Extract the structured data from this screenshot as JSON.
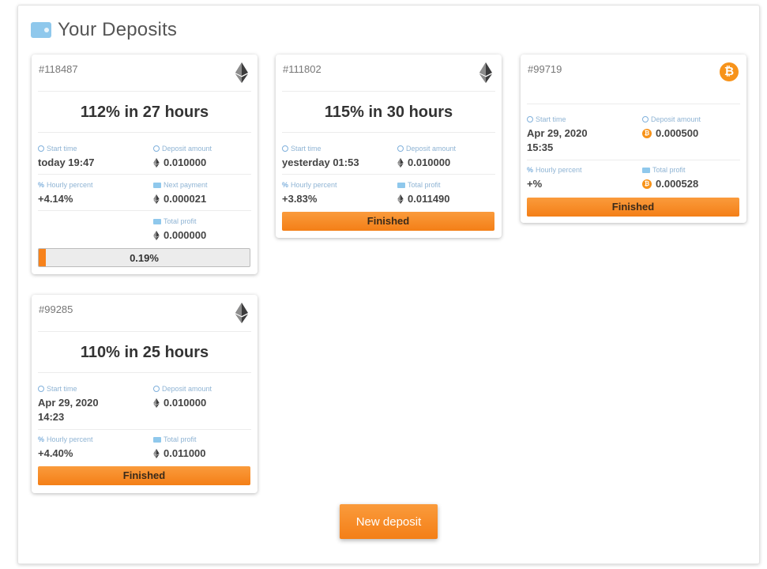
{
  "header": {
    "title": "Your Deposits",
    "icon": "wallet-icon"
  },
  "colors": {
    "accent": "#f7821b",
    "label_blue": "#8fb4d4",
    "btc": "#f7931a"
  },
  "cards": [
    {
      "id": "#118487",
      "coin": "ethereum",
      "rate": "112% in 27 hours",
      "start_time_label": "Start time",
      "start_time": "today 19:47",
      "deposit_amount_label": "Deposit amount",
      "deposit_amount": "0.010000",
      "hourly_percent_label": "Hourly percent",
      "hourly_percent": "+4.14%",
      "next_payment_label": "Next payment",
      "next_payment": "0.000021",
      "total_profit_label": "Total profit",
      "total_profit": "0.000000",
      "progress_text": "0.19%",
      "progress_value": 0.0319
    },
    {
      "id": "#111802",
      "coin": "ethereum",
      "rate": "115% in 30 hours",
      "start_time_label": "Start time",
      "start_time": "yesterday 01:53",
      "deposit_amount_label": "Deposit amount",
      "deposit_amount": "0.010000",
      "hourly_percent_label": "Hourly percent",
      "hourly_percent": "+3.83%",
      "total_profit_label": "Total profit",
      "total_profit": "0.011490",
      "status": "Finished"
    },
    {
      "id": "#99719",
      "coin": "bitcoin",
      "start_time_label": "Start time",
      "start_time_line1": "Apr 29, 2020",
      "start_time_line2": "15:35",
      "deposit_amount_label": "Deposit amount",
      "deposit_amount": "0.000500",
      "hourly_percent_label": "Hourly percent",
      "hourly_percent": "+%",
      "total_profit_label": "Total profit",
      "total_profit": "0.000528",
      "status": "Finished"
    },
    {
      "id": "#99285",
      "coin": "ethereum",
      "rate": "110% in 25 hours",
      "start_time_label": "Start time",
      "start_time_line1": "Apr 29, 2020",
      "start_time_line2": "14:23",
      "deposit_amount_label": "Deposit amount",
      "deposit_amount": "0.010000",
      "hourly_percent_label": "Hourly percent",
      "hourly_percent": "+4.40%",
      "total_profit_label": "Total profit",
      "total_profit": "0.011000",
      "status": "Finished"
    }
  ],
  "actions": {
    "new_deposit_label": "New deposit"
  }
}
